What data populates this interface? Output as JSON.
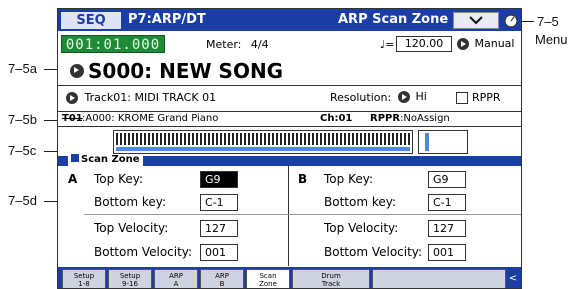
{
  "callouts": {
    "menu_top": "7–5",
    "menu_bottom": "Menu",
    "label_5a": "7–5a",
    "label_5b": "7–5b",
    "label_5c": "7–5c",
    "label_5d": "7–5d"
  },
  "header": {
    "mode": "SEQ",
    "page": "P7:ARP/DT",
    "page_name": "ARP Scan Zone"
  },
  "position": "001:01.000",
  "meter": {
    "label": "Meter:",
    "value": "4/4"
  },
  "tempo": {
    "symbol": "♩=",
    "value": "120.00",
    "mode": "Manual"
  },
  "song": {
    "name": "S000: NEW SONG"
  },
  "track_row": {
    "track": "Track01: MIDI TRACK 01",
    "resolution_label": "Resolution:",
    "resolution_value": "Hi",
    "rppr_label": "RPPR"
  },
  "track_info": {
    "track": "T01",
    "program": ":A000: KROME Grand Piano",
    "channel": "Ch:01",
    "rppr_label": "RPPR",
    "rppr_value": ":NoAssign"
  },
  "scan_zone": {
    "title": "Scan Zone",
    "section_a": "A",
    "section_b": "B",
    "a": {
      "top_key_label": "Top Key:",
      "top_key": "G9",
      "bottom_key_label": "Bottom key:",
      "bottom_key": "C-1",
      "top_velocity_label": "Top Velocity:",
      "top_velocity": "127",
      "bottom_velocity_label": "Bottom Velocity:",
      "bottom_velocity": "001"
    },
    "b": {
      "top_key_label": "Top Key:",
      "top_key": "G9",
      "bottom_key_label": "Bottom key:",
      "bottom_key": "C-1",
      "top_velocity_label": "Top Velocity:",
      "top_velocity": "127",
      "bottom_velocity_label": "Bottom Velocity:",
      "bottom_velocity": "001"
    }
  },
  "tabs": [
    {
      "l1": "Setup",
      "l2": "1-8"
    },
    {
      "l1": "Setup",
      "l2": "9-16"
    },
    {
      "l1": "ARP",
      "l2": "A"
    },
    {
      "l1": "ARP",
      "l2": "B"
    },
    {
      "l1": "Scan",
      "l2": "Zone"
    },
    {
      "l1": "Drum",
      "l2": "Track"
    }
  ],
  "icons": {
    "menu_icon": "chevron-down-icon",
    "settings_icon": "knob-icon",
    "tab_scroll": "chevron-left-icon"
  }
}
